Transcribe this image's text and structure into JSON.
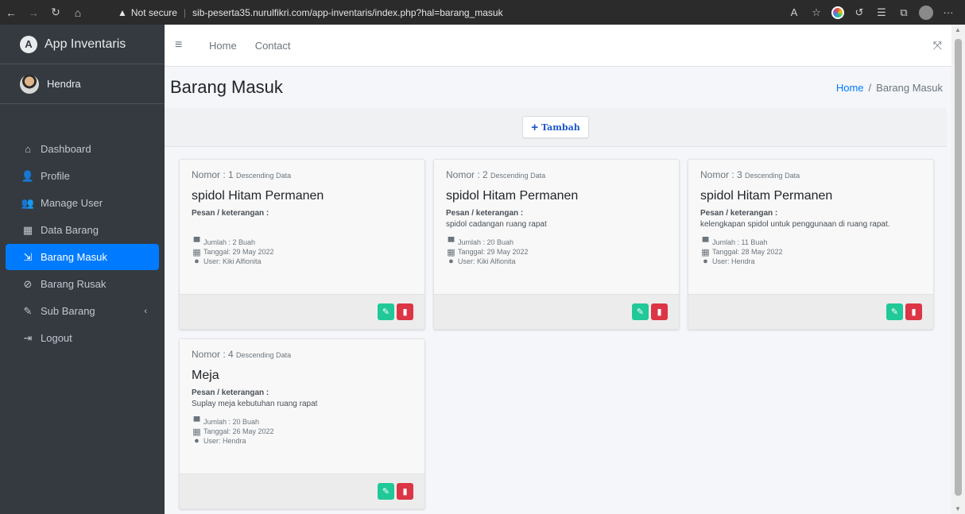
{
  "browser": {
    "not_secure": "Not secure",
    "url": "sib-peserta35.nurulfikri.com/app-inventaris/index.php?hal=barang_masuk"
  },
  "sidebar": {
    "brand": "App Inventaris",
    "brand_logo": "A",
    "user_name": "Hendra",
    "items": [
      {
        "label": "Dashboard",
        "icon": "home-icon",
        "glyph": "⌂"
      },
      {
        "label": "Profile",
        "icon": "user-icon",
        "glyph": "👤"
      },
      {
        "label": "Manage User",
        "icon": "users-icon",
        "glyph": "👥"
      },
      {
        "label": "Data Barang",
        "icon": "boxes-icon",
        "glyph": "▦"
      },
      {
        "label": "Barang Masuk",
        "icon": "dolly-icon",
        "glyph": "⇲"
      },
      {
        "label": "Barang Rusak",
        "icon": "broken-icon",
        "glyph": "⊘"
      },
      {
        "label": "Sub Barang",
        "icon": "edit-icon",
        "glyph": "✎"
      },
      {
        "label": "Logout",
        "icon": "logout-icon",
        "glyph": "⇥"
      }
    ]
  },
  "topnav": {
    "home": "Home",
    "contact": "Contact"
  },
  "header": {
    "title": "Barang Masuk",
    "breadcrumb_home": "Home",
    "breadcrumb_sep": "/",
    "breadcrumb_current": "Barang Masuk"
  },
  "actions": {
    "tambah": "Tambah"
  },
  "cards": [
    {
      "nomor_label": "Nomor : 1",
      "desc": "Descending Data",
      "title": "spidol Hitam Permanen",
      "pesan_label": "Pesan / keterangan :",
      "pesan": "",
      "jumlah": "Jumlah : 2 Buah",
      "tanggal": "Tanggal: 29 May 2022",
      "user": "User: Kiki Alfionita"
    },
    {
      "nomor_label": "Nomor : 2",
      "desc": "Descending Data",
      "title": "spidol Hitam Permanen",
      "pesan_label": "Pesan / keterangan :",
      "pesan": "spidol cadangan ruang rapat",
      "jumlah": "Jumlah : 20 Buah",
      "tanggal": "Tanggal: 29 May 2022",
      "user": "User: Kiki Alfionita"
    },
    {
      "nomor_label": "Nomor : 3",
      "desc": "Descending Data",
      "title": "spidol Hitam Permanen",
      "pesan_label": "Pesan / keterangan :",
      "pesan": "kelengkapan spidol untuk penggunaan di ruang rapat.",
      "jumlah": "Jumlah : 11 Buah",
      "tanggal": "Tanggal: 28 May 2022",
      "user": "User: Hendra"
    },
    {
      "nomor_label": "Nomor : 4",
      "desc": "Descending Data",
      "title": "Meja",
      "pesan_label": "Pesan / keterangan :",
      "pesan": "Suplay meja kebutuhan ruang rapat",
      "jumlah": "Jumlah : 20 Buah",
      "tanggal": "Tanggal: 26 May 2022",
      "user": "User: Hendra"
    }
  ],
  "colors": {
    "sidebar_bg": "#343a40",
    "active": "#007bff",
    "edit": "#20c997",
    "delete": "#dc3545"
  }
}
